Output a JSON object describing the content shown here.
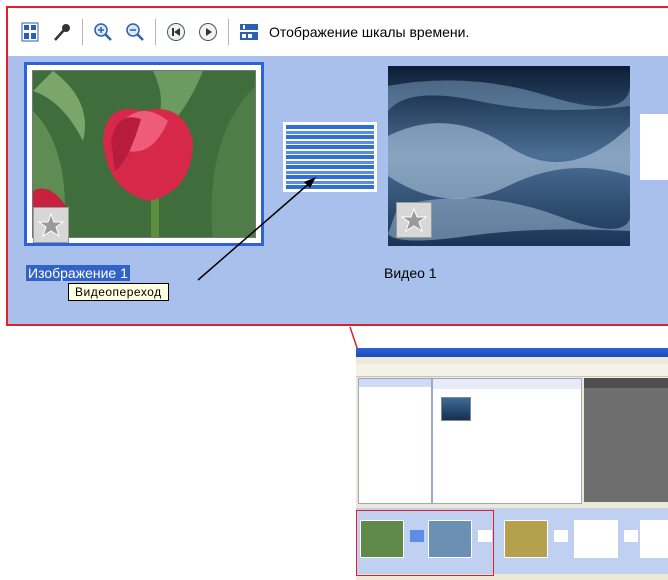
{
  "toolbar": {
    "label": "Отображение шкалы времени.",
    "buttons": [
      "storyboard-icon",
      "narrate-icon",
      "zoom-in-icon",
      "zoom-out-icon",
      "rewind-icon",
      "play-icon",
      "timeline-icon"
    ]
  },
  "clips": [
    {
      "label": "Изображение 1",
      "selected": true
    },
    {
      "label": "Видео 1",
      "selected": false
    }
  ],
  "tooltip": "Видеопереход",
  "colors": {
    "accent_red": "#e0202a",
    "storyboard_bg": "#a9c0ec",
    "selection": "#3163c6"
  }
}
